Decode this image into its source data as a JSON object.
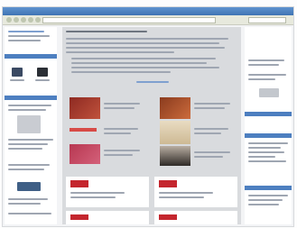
{
  "browser": {
    "address": "",
    "accent": "#4d7fc0"
  },
  "left_sidebar": {
    "section_titles": [
      "",
      ""
    ],
    "menu_icon_names": [
      "home-icon",
      "monitor-icon"
    ]
  },
  "center": {
    "intro": "",
    "more_link": ""
  },
  "right_sidebar": {
    "section_titles": [
      "",
      ""
    ]
  },
  "colors": {
    "content_bg": "#d9dbde",
    "sidebar_bg": "#ffffff",
    "brand_red": "#c4262e"
  }
}
